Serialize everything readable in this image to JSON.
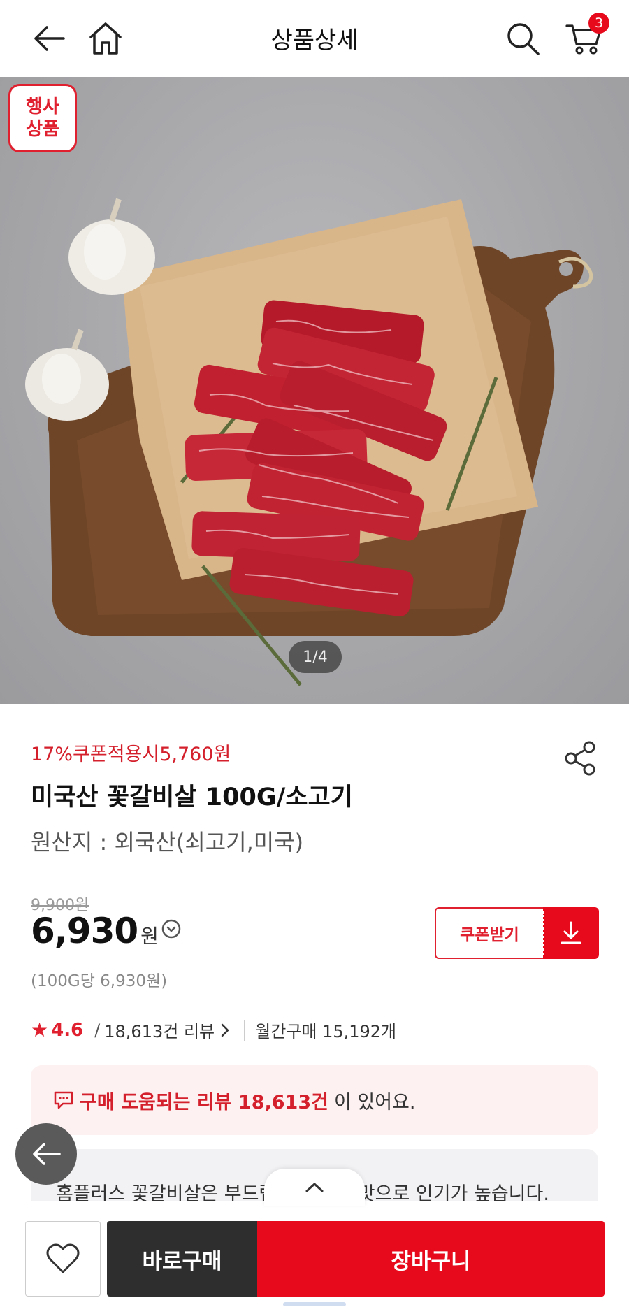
{
  "header": {
    "title": "상품상세",
    "cart_count": "3"
  },
  "hero": {
    "event_badge_line1": "행사",
    "event_badge_line2": "상품",
    "counter": "1/4"
  },
  "product": {
    "coupon_line": "17%쿠폰적용시5,760원",
    "name": "미국산 꽃갈비살 100G/소고기",
    "origin": "원산지 : 외국산(쇠고기,미국)",
    "original_price": "9,900원",
    "price": "6,930",
    "price_unit": "원",
    "unit_price": "(100G당 6,930원)",
    "coupon_button": "쿠폰받기"
  },
  "rating": {
    "score": "4.6",
    "separator": "/",
    "reviews": "18,613건 리뷰",
    "monthly": "월간구매 15,192개"
  },
  "review_box": {
    "highlight": "구매 도움되는 리뷰 18,613건",
    "rest": "이 있어요."
  },
  "summary": {
    "text": "홈플러스 꽃갈비살은 부드럽고 고소한 맛으로 인기가 높습니다."
  },
  "bottom_bar": {
    "buy_now": "바로구매",
    "add_to_cart": "장바구니"
  },
  "colors": {
    "accent": "#e60a1c",
    "dark_button": "#2e2e2e"
  }
}
